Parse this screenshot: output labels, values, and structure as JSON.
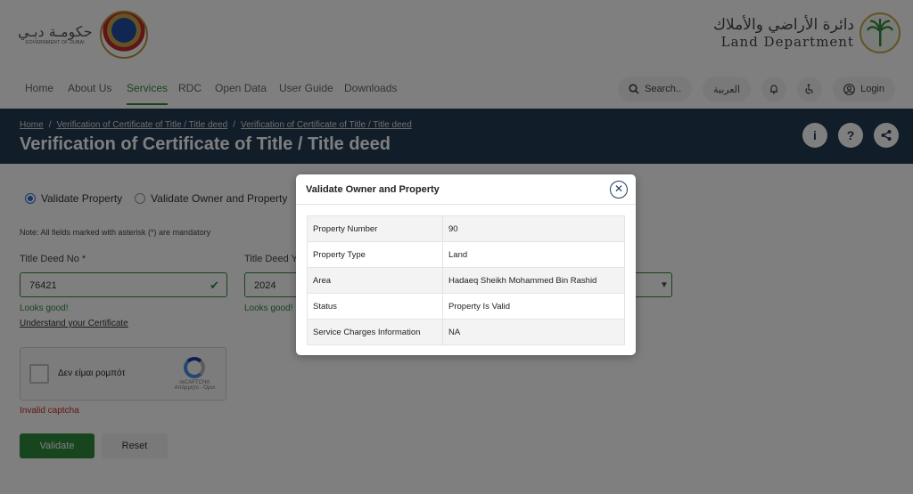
{
  "header": {
    "gov_logo_ar": "حكومـة دبـي",
    "gov_logo_en": "GOVERNMENT OF DUBAI",
    "ld_logo_ar": "دائرة الأراضي والأملاك",
    "ld_logo_en": "Land Department"
  },
  "nav": {
    "items": [
      "Home",
      "About Us",
      "Services",
      "RDC",
      "Open Data",
      "User Guide",
      "Downloads"
    ],
    "active": "Services",
    "search_label": "Search..",
    "arabic_label": "العربية",
    "login_label": "Login"
  },
  "banner": {
    "breadcrumbs": [
      "Home",
      "Verification of Certificate of Title / Title deed",
      "Verification of Certificate of Title / Title deed"
    ],
    "title": "Verification of Certificate of Title / Title deed"
  },
  "form": {
    "radio_options": [
      "Validate Property",
      "Validate Owner and Property"
    ],
    "selected_option": "Validate Property",
    "note": "Note: All fields marked with asterisk (*) are mandatory",
    "title_deed_no_label": "Title Deed No *",
    "title_deed_no_value": "76421",
    "title_deed_year_label": "Title Deed Y",
    "title_deed_year_value": "2024",
    "looks_good": "Looks good!",
    "understand_link": "Understand your Certificate",
    "captcha_label": "Δεν είμαι ρομπότ",
    "captcha_brand": "reCAPTCHA",
    "captcha_terms": "Απόρρητο - Όροι",
    "captcha_error": "Invalid captcha",
    "validate_button": "Validate",
    "reset_button": "Reset"
  },
  "modal": {
    "title": "Validate Owner and Property",
    "rows": [
      {
        "key": "Property Number",
        "value": "90"
      },
      {
        "key": "Property Type",
        "value": "Land"
      },
      {
        "key": "Area",
        "value": "Hadaeq Sheikh Mohammed Bin Rashid"
      },
      {
        "key": "Status",
        "value": "Property Is Valid"
      },
      {
        "key": "Service Charges Information",
        "value": "NA"
      }
    ]
  },
  "colors": {
    "accent_green": "#2f8a3b",
    "banner_navy": "#243b55",
    "error_red": "#c62828"
  }
}
